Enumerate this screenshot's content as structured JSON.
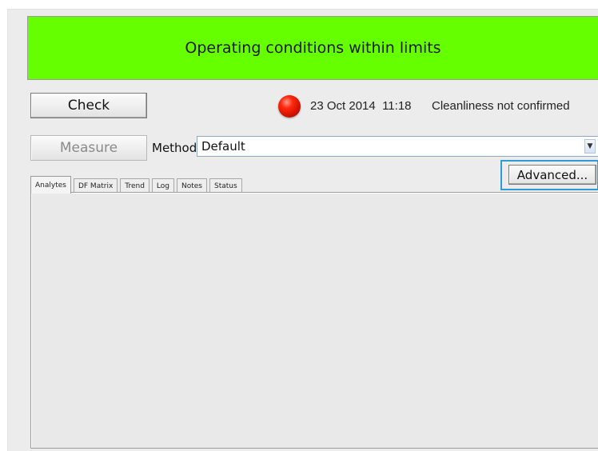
{
  "status_banner": {
    "text": "Operating conditions within limits",
    "color": "#66ff00"
  },
  "check_button": {
    "label": "Check"
  },
  "indicator": {
    "state": "red",
    "color": "#e01a00"
  },
  "status": {
    "date": "23 Oct 2014",
    "time": "11:18",
    "cleanliness": "Cleanliness not confirmed"
  },
  "measure_button": {
    "label": "Measure",
    "enabled": false
  },
  "method": {
    "label": "Method",
    "value": "Default"
  },
  "advanced_button": {
    "label": "Advanced..."
  },
  "tabs": [
    {
      "label": "Analytes",
      "active": true
    },
    {
      "label": "DF Matrix",
      "active": false
    },
    {
      "label": "Trend",
      "active": false
    },
    {
      "label": "Log",
      "active": false
    },
    {
      "label": "Notes",
      "active": false
    },
    {
      "label": "Status",
      "active": false
    }
  ]
}
